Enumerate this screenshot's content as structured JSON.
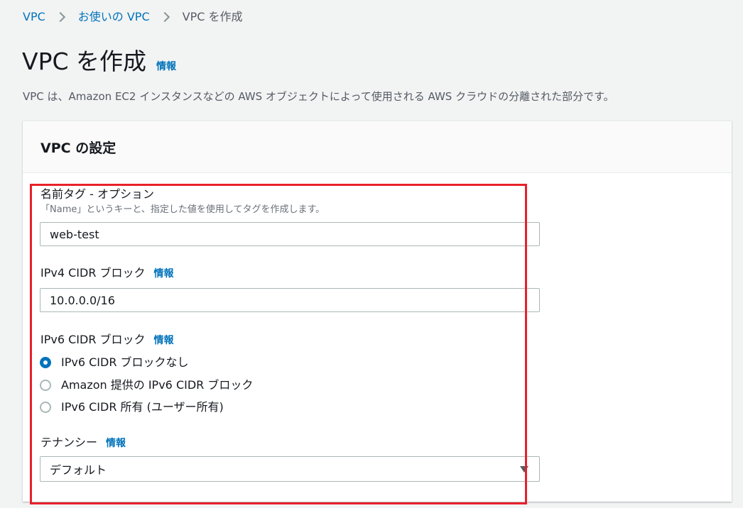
{
  "breadcrumb": {
    "items": [
      "VPC",
      "お使いの VPC",
      "VPC を作成"
    ]
  },
  "header": {
    "title": "VPC を作成",
    "info": "情報",
    "description": "VPC は、Amazon EC2 インスタンスなどの AWS オブジェクトによって使用される AWS クラウドの分離された部分です。"
  },
  "panel": {
    "title": "VPC の設定"
  },
  "name_tag": {
    "label": "名前タグ - オプション",
    "description": "「Name」というキーと、指定した値を使用してタグを作成します。",
    "value": "web-test"
  },
  "ipv4": {
    "label": "IPv4 CIDR ブロック",
    "info": "情報",
    "value": "10.0.0.0/16"
  },
  "ipv6": {
    "label": "IPv6 CIDR ブロック",
    "info": "情報",
    "options": [
      {
        "label": "IPv6 CIDR ブロックなし",
        "selected": true
      },
      {
        "label": "Amazon 提供の IPv6 CIDR ブロック",
        "selected": false
      },
      {
        "label": "IPv6 CIDR 所有 (ユーザー所有)",
        "selected": false
      }
    ]
  },
  "tenancy": {
    "label": "テナンシー",
    "info": "情報",
    "selected": "デフォルト"
  },
  "colors": {
    "link": "#0073bb",
    "highlight": "#e8202a",
    "radio_checked": "#0073bb"
  }
}
